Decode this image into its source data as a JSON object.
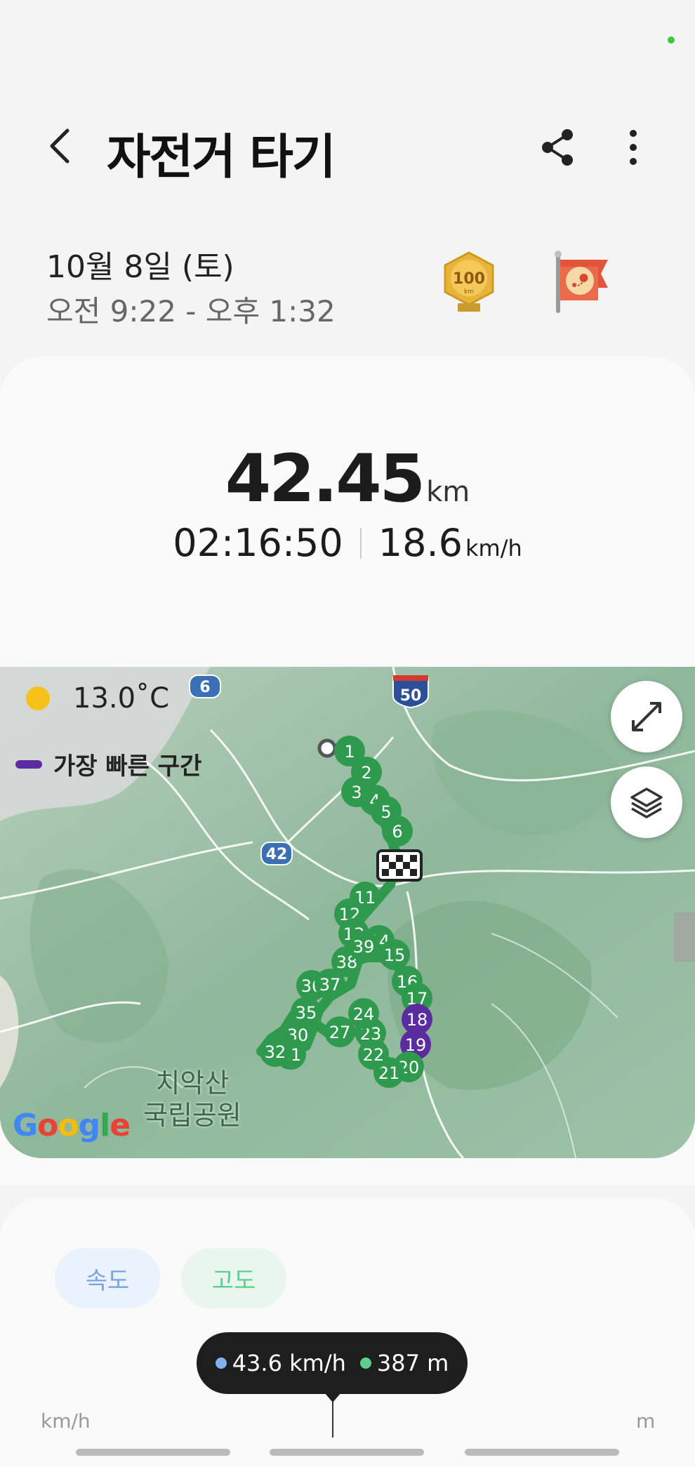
{
  "header": {
    "title": "자전거 타기",
    "back_icon": "chevron-left-icon",
    "share_icon": "share-icon",
    "more_icon": "more-vertical-icon"
  },
  "session": {
    "date": "10월 8일 (토)",
    "time_range": "오전 9:22 - 오후 1:32",
    "medal_text": "100",
    "medal_unit": "km"
  },
  "summary": {
    "distance_value": "42.45",
    "distance_unit": "km",
    "duration": "02:16:50",
    "speed_value": "18.6",
    "speed_unit": "km/h"
  },
  "map": {
    "temperature": "13.0˚C",
    "legend_label": "가장 빠른 구간",
    "legend_color": "#5b2ca0",
    "route_color": "#2f9a4e",
    "road_shield_6": "6",
    "road_shield_42": "42",
    "highway_shield_50": "50",
    "park_label_line1": "치악산",
    "park_label_line2": "국립공원",
    "attribution": "Google",
    "markers": [
      {
        "label": "1",
        "fast": false
      },
      {
        "label": "2",
        "fast": false
      },
      {
        "label": "3",
        "fast": false
      },
      {
        "label": "4",
        "fast": false
      },
      {
        "label": "5",
        "fast": false
      },
      {
        "label": "6",
        "fast": false
      },
      {
        "label": "11",
        "fast": false
      },
      {
        "label": "12",
        "fast": false
      },
      {
        "label": "13",
        "fast": false
      },
      {
        "label": "14",
        "fast": false
      },
      {
        "label": "15",
        "fast": false
      },
      {
        "label": "16",
        "fast": false
      },
      {
        "label": "17",
        "fast": false
      },
      {
        "label": "18",
        "fast": true
      },
      {
        "label": "19",
        "fast": true
      },
      {
        "label": "20",
        "fast": false
      },
      {
        "label": "21",
        "fast": false
      },
      {
        "label": "22",
        "fast": false
      },
      {
        "label": "23",
        "fast": false
      },
      {
        "label": "24",
        "fast": false
      },
      {
        "label": "27",
        "fast": false
      },
      {
        "label": "30",
        "fast": false
      },
      {
        "label": "31",
        "fast": false
      },
      {
        "label": "32",
        "fast": false
      },
      {
        "label": "35",
        "fast": false
      },
      {
        "label": "36",
        "fast": false
      },
      {
        "label": "37",
        "fast": false
      },
      {
        "label": "38",
        "fast": false
      },
      {
        "label": "39",
        "fast": false
      }
    ]
  },
  "chart": {
    "tab_speed": "속도",
    "tab_altitude": "고도",
    "tooltip_speed": "43.6 km/h",
    "tooltip_altitude": "387 m",
    "speed_color": "#7fb2f0",
    "altitude_color": "#5fcf8f",
    "axis_left_unit": "km/h",
    "axis_right_unit": "m"
  }
}
